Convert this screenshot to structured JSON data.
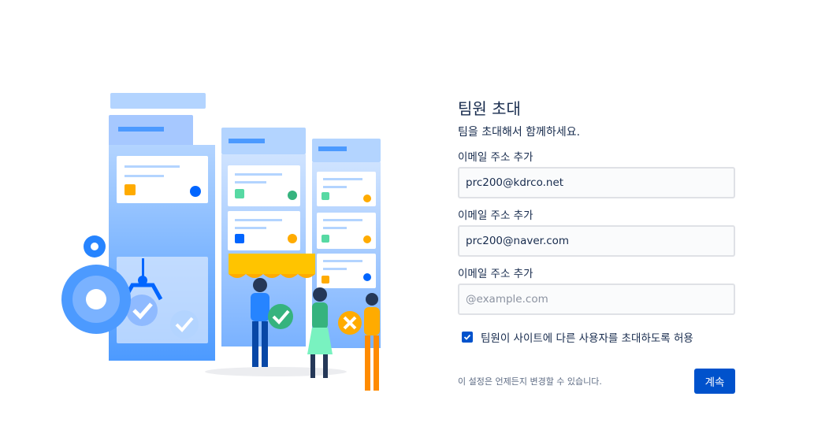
{
  "heading": {
    "title": "팀원 초대",
    "subtitle": "팀을 초대해서 함께하세요."
  },
  "email_fields": [
    {
      "label": "이메일 주소 추가",
      "value": "prc200@kdrco.net",
      "placeholder": ""
    },
    {
      "label": "이메일 주소 추가",
      "value": "prc200@naver.com",
      "placeholder": ""
    },
    {
      "label": "이메일 주소 추가",
      "value": "",
      "placeholder": "@example.com"
    }
  ],
  "permission": {
    "label": "팀원이 사이트에 다른 사용자를 초대하도록 허용",
    "checked": true
  },
  "footer": {
    "note": "이 설정은 언제든지 변경할 수 있습니다.",
    "continue_label": "계속"
  },
  "colors": {
    "primary": "#0052cc",
    "text": "#172b4d",
    "input_border": "#dfe1e6",
    "input_bg": "#fafbfc"
  },
  "icons": {
    "checkbox": "checkmark-icon",
    "illustration": "team-board-illustration"
  }
}
